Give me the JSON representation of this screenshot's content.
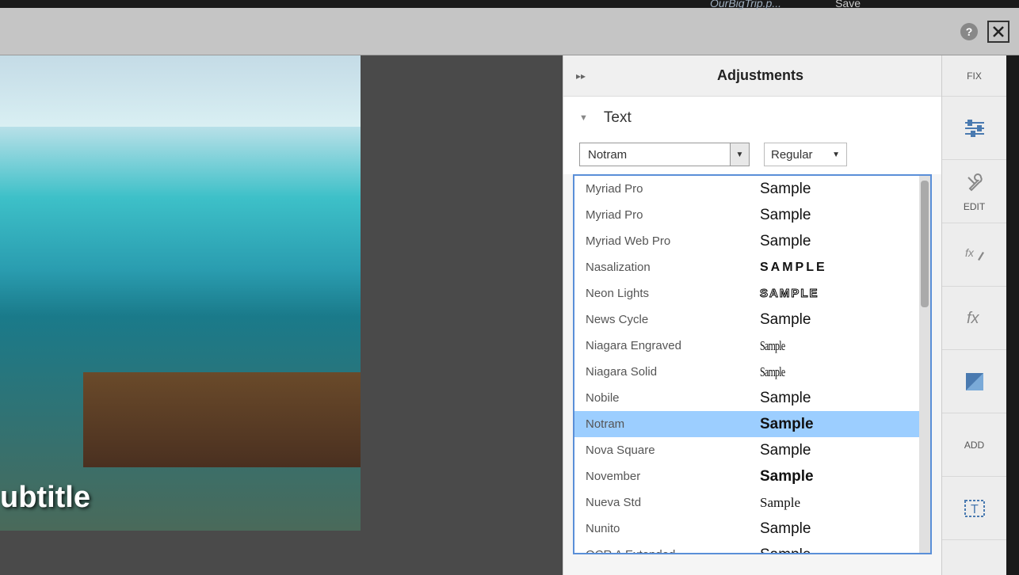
{
  "header": {
    "filename": "OurBigTrip.p...",
    "save": "Save"
  },
  "titlebar": {
    "help_tooltip": "?"
  },
  "canvas": {
    "subtitle": "ubtitle"
  },
  "adjustments": {
    "panel_title": "Adjustments",
    "fix_label": "FIX",
    "section_label": "Text",
    "font_selected": "Notram",
    "weight_selected": "Regular",
    "fonts": [
      {
        "name": "Myriad Pro",
        "sample": "Sample",
        "style": ""
      },
      {
        "name": "Myriad Pro",
        "sample": "Sample",
        "style": ""
      },
      {
        "name": "Myriad Web Pro",
        "sample": "Sample",
        "style": ""
      },
      {
        "name": "Nasalization",
        "sample": "SAMPLE",
        "style": "spaced"
      },
      {
        "name": "Neon Lights",
        "sample": "SAMPLE",
        "style": "outline"
      },
      {
        "name": "News Cycle",
        "sample": "Sample",
        "style": ""
      },
      {
        "name": "Niagara Engraved",
        "sample": "Sample",
        "style": "condensed serif-small"
      },
      {
        "name": "Niagara Solid",
        "sample": "Sample",
        "style": "condensed serif-small"
      },
      {
        "name": "Nobile",
        "sample": "Sample",
        "style": ""
      },
      {
        "name": "Notram",
        "sample": "Sample",
        "style": "bold",
        "selected": true
      },
      {
        "name": "Nova Square",
        "sample": "Sample",
        "style": ""
      },
      {
        "name": "November",
        "sample": "Sample",
        "style": "bold"
      },
      {
        "name": "Nueva Std",
        "sample": "Sample",
        "style": "serif-small"
      },
      {
        "name": "Nunito",
        "sample": "Sample",
        "style": ""
      },
      {
        "name": "OCR A Extended",
        "sample": "Sample",
        "style": ""
      }
    ]
  },
  "toolrail": {
    "edit_label": "EDIT",
    "add_label": "ADD"
  }
}
